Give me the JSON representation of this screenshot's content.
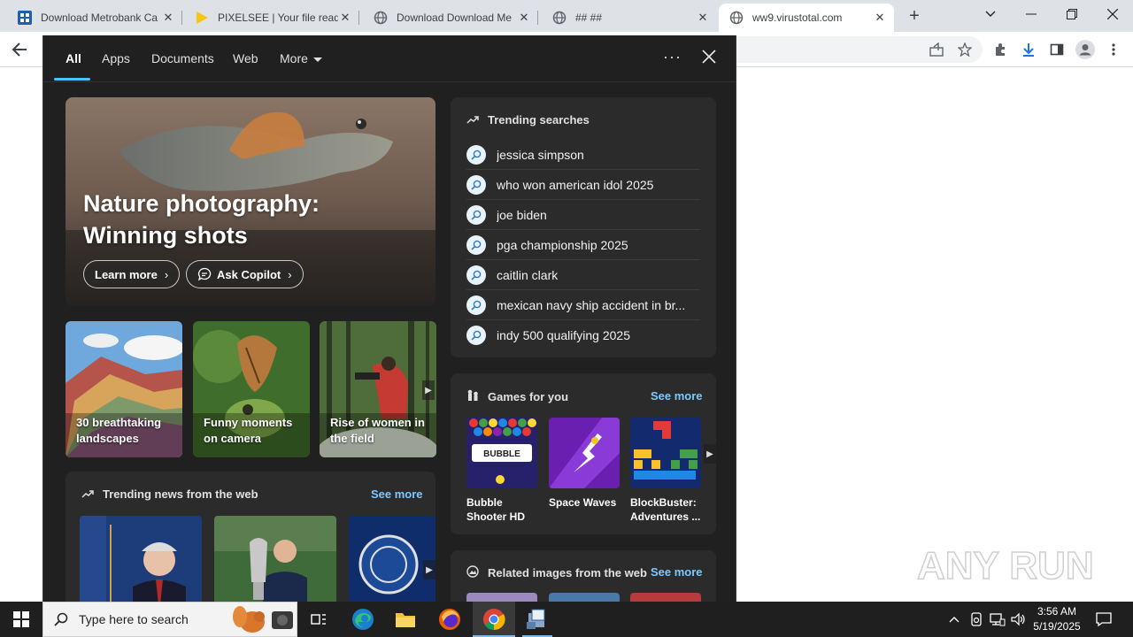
{
  "browser": {
    "tabs": [
      {
        "title": "Download Metrobank Ca",
        "icon": "metrobank-icon"
      },
      {
        "title": "PIXELSEE | Your file ready",
        "icon": "play-icon"
      },
      {
        "title": "Download Download Me",
        "icon": "globe-icon"
      },
      {
        "title": "## ##",
        "icon": "globe-icon"
      },
      {
        "title": "ww9.virustotal.com",
        "icon": "globe-icon",
        "active": true
      }
    ]
  },
  "flyout": {
    "tabs": [
      "All",
      "Apps",
      "Documents",
      "Web",
      "More"
    ],
    "active_tab": "All",
    "more_icon": "ellipsis-icon",
    "hero": {
      "title": "Nature photography: Winning shots",
      "learn_more": "Learn more",
      "ask_copilot": "Ask Copilot"
    },
    "cards": [
      {
        "label": "30 breathtaking landscapes"
      },
      {
        "label": "Funny moments on camera"
      },
      {
        "label": "Rise of women in the field"
      }
    ],
    "news": {
      "title": "Trending news from the web",
      "see_more": "See more"
    },
    "trending": {
      "title": "Trending searches",
      "items": [
        "jessica simpson",
        "who won american idol 2025",
        "joe biden",
        "pga championship 2025",
        "caitlin clark",
        "mexican navy ship accident in br...",
        "indy 500 qualifying 2025"
      ]
    },
    "games": {
      "title": "Games for you",
      "see_more": "See more",
      "items": [
        {
          "label": "Bubble Shooter HD"
        },
        {
          "label": "Space Waves"
        },
        {
          "label": "BlockBuster: Adventures ..."
        }
      ]
    },
    "related": {
      "title": "Related images from the web",
      "see_more": "See more"
    }
  },
  "taskbar": {
    "search_placeholder": "Type here to search",
    "time": "3:56 AM",
    "date": "5/19/2025"
  },
  "watermark": "ANY RUN",
  "colors": {
    "flyout_bg": "#202020",
    "panel_bg": "#2b2b2b",
    "accent": "#4cc2ff",
    "link": "#7cc8ff",
    "taskbar_bg": "#1f1f1f"
  }
}
